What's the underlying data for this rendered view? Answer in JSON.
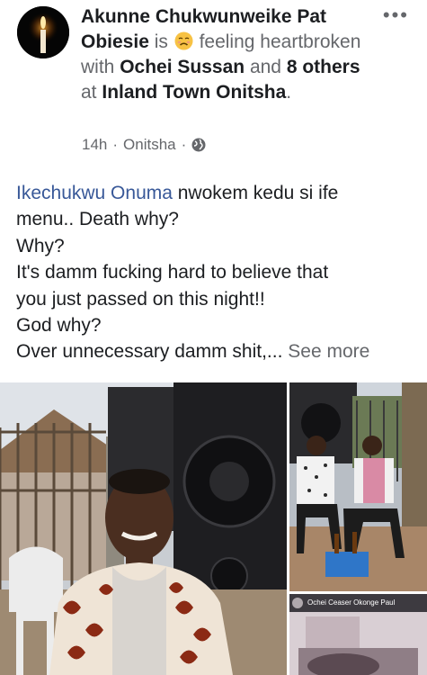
{
  "post": {
    "author_name": "Akunne Chukwunweike Pat Obiesie",
    "is_text": "is",
    "feeling_text": "feeling heartbroken with",
    "tagged_person": "Ochei Sussan",
    "and_text": "and",
    "others": "8 others",
    "at_text": "at",
    "location": "Inland Town Onitsha",
    "period": ".",
    "time": "14h",
    "place": "Onitsha",
    "separator": "·",
    "more_label": "•••",
    "emoji_icon": "sad-face-icon",
    "privacy_icon": "globe-icon"
  },
  "body": {
    "mention": "Ikechukwu Onuma",
    "line1_rest": " nwokem kedu si ife",
    "line2": "menu.. Death why?",
    "line3": "Why?",
    "line4": "It's damm fucking hard to believe that",
    "line5": "you just passed on this night!!",
    "line6": "God why?",
    "line7": "Over unnecessary damm shit,...",
    "see_more": "See more"
  },
  "photos": {
    "overlay_caption": "Ochei Ceaser Okonge Paul"
  },
  "colors": {
    "link": "#385898",
    "secondary_text": "#65676b",
    "primary_text": "#1c1e21"
  }
}
